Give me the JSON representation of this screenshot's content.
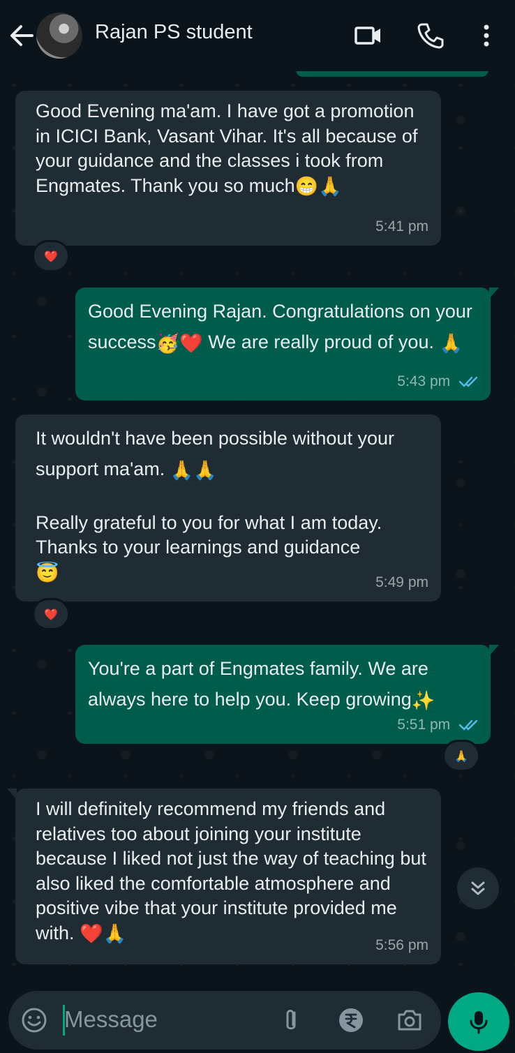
{
  "header": {
    "contact_name": "Rajan PS student",
    "icons": [
      "back-arrow-icon",
      "video-call-icon",
      "voice-call-icon",
      "more-options-icon"
    ]
  },
  "messages": [
    {
      "direction": "incoming",
      "text": "Good Evening ma'am. I have got a promotion in ICICI Bank, Vasant Vihar. It's all because of your guidance and the classes i took from Engmates. Thank you so much",
      "emojis": "😁🙏",
      "time": "5:41 pm",
      "reaction": "❤️"
    },
    {
      "direction": "outgoing",
      "text_a": "Good Evening Rajan. Congratulations on your success",
      "emojis_a": "🥳❤️",
      "text_b": " We are really proud of you.",
      "emojis_b": "🙏",
      "time": "5:43 pm",
      "status": "read"
    },
    {
      "direction": "incoming",
      "text_a": "It wouldn't have been possible without your support ma'am.",
      "emojis_a": "🙏🙏",
      "text_b": "Really grateful to you for what I am today. Thanks to your learnings and guidance",
      "emojis_b": "😇",
      "time": "5:49 pm",
      "reaction": "❤️"
    },
    {
      "direction": "outgoing",
      "text": "You're a part of Engmates family. We are always here to help you. Keep growing",
      "emojis": "✨",
      "time": "5:51 pm",
      "status": "read",
      "reaction": "🙏"
    },
    {
      "direction": "incoming",
      "text": "I will definitely recommend my friends and relatives too about joining your institute because I liked not just the way of teaching but also liked the comfortable atmosphere and positive vibe that your institute provided me with.",
      "emojis": "❤️🙏",
      "time": "5:56 pm"
    }
  ],
  "composer": {
    "placeholder": "Message",
    "icons": [
      "emoji-icon",
      "attach-icon",
      "rupee-payment-icon",
      "camera-icon",
      "mic-icon"
    ]
  },
  "colors": {
    "background": "#0b141a",
    "incoming_bubble": "#202c33",
    "outgoing_bubble": "#005c4b",
    "accent": "#00a884",
    "read_ticks": "#53bdeb"
  }
}
